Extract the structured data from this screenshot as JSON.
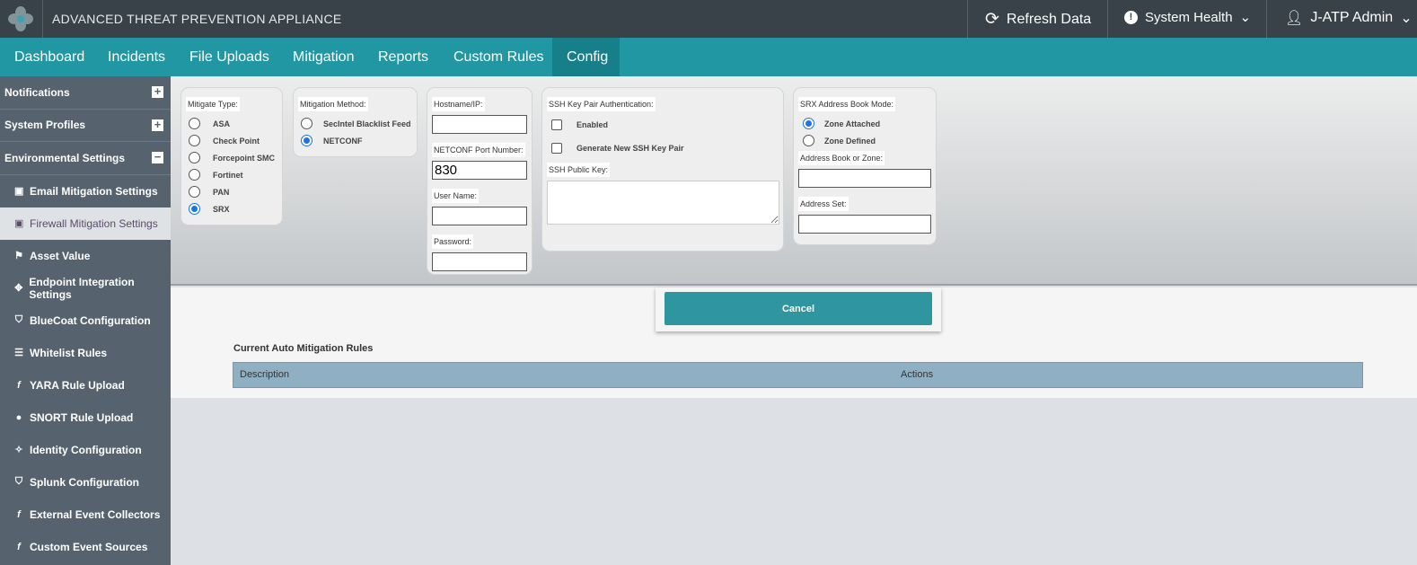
{
  "header": {
    "app_title": "ADVANCED THREAT PREVENTION APPLIANCE",
    "refresh": "Refresh Data",
    "health": "System Health",
    "user": "J-ATP Admin"
  },
  "nav": [
    "Dashboard",
    "Incidents",
    "File Uploads",
    "Mitigation",
    "Reports",
    "Custom Rules",
    "Config"
  ],
  "nav_active": "Config",
  "sidebar": {
    "sections": [
      "Notifications",
      "System Profiles",
      "Environmental Settings"
    ],
    "items": [
      "Email Mitigation Settings",
      "Firewall Mitigation Settings",
      "Asset Value",
      "Endpoint Integration Settings",
      "BlueCoat Configuration",
      "Whitelist Rules",
      "YARA Rule Upload",
      "SNORT Rule Upload",
      "Identity Configuration",
      "Splunk Configuration",
      "External Event Collectors",
      "Custom Event Sources"
    ],
    "active": "Firewall Mitigation Settings"
  },
  "form": {
    "mitigate_type": {
      "label": "Mitigate Type:",
      "options": [
        "ASA",
        "Check Point",
        "Forcepoint SMC",
        "Fortinet",
        "PAN",
        "SRX"
      ],
      "selected": "SRX"
    },
    "method": {
      "label": "Mitigation Method:",
      "options": [
        "SecIntel Blacklist Feed",
        "NETCONF"
      ],
      "selected": "NETCONF"
    },
    "hostname_label": "Hostname/IP:",
    "hostname": "",
    "port_label": "NETCONF Port Number:",
    "port": "830",
    "user_label": "User Name:",
    "user": "",
    "password_label": "Password:",
    "password": "",
    "ssh_label": "SSH Key Pair Authentication:",
    "ssh_enabled": "Enabled",
    "ssh_generate": "Generate New SSH Key Pair",
    "pubkey_label": "SSH Public Key:",
    "pubkey": "",
    "srx_mode": {
      "label": "SRX Address Book Mode:",
      "options": [
        "Zone Attached",
        "Zone Defined"
      ],
      "selected": "Zone Attached"
    },
    "addrbook_label": "Address Book or Zone:",
    "addrbook": "",
    "addrset_label": "Address Set:",
    "addrset": ""
  },
  "cancel": "Cancel",
  "rules": {
    "title": "Current Auto Mitigation Rules",
    "columns": [
      "Description",
      "Actions"
    ]
  },
  "colors": {
    "header": "#394249",
    "nav": "#2197a3",
    "accent": "#2f959f",
    "sidebar": "#56636f"
  }
}
